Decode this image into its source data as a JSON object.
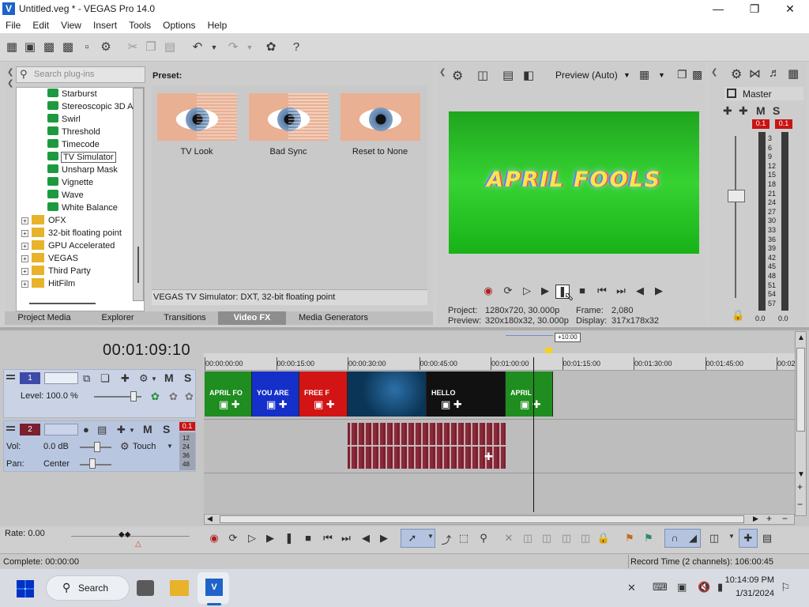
{
  "window": {
    "title": "Untitled.veg * - VEGAS Pro 14.0"
  },
  "menu": [
    "File",
    "Edit",
    "View",
    "Insert",
    "Tools",
    "Options",
    "Help"
  ],
  "plugins": {
    "search_placeholder": "Search plug-ins",
    "tree": [
      {
        "label": "Starburst",
        "kind": "fx"
      },
      {
        "label": "Stereoscopic 3D A",
        "kind": "fx"
      },
      {
        "label": "Swirl",
        "kind": "fx"
      },
      {
        "label": "Threshold",
        "kind": "fx"
      },
      {
        "label": "Timecode",
        "kind": "fx"
      },
      {
        "label": "TV Simulator",
        "kind": "fx",
        "selected": true
      },
      {
        "label": "Unsharp Mask",
        "kind": "fx"
      },
      {
        "label": "Vignette",
        "kind": "fx"
      },
      {
        "label": "Wave",
        "kind": "fx"
      },
      {
        "label": "White Balance",
        "kind": "fx"
      },
      {
        "label": "OFX",
        "kind": "folder"
      },
      {
        "label": "32-bit floating point",
        "kind": "folder"
      },
      {
        "label": "GPU Accelerated",
        "kind": "folder"
      },
      {
        "label": "VEGAS",
        "kind": "folder"
      },
      {
        "label": "Third Party",
        "kind": "folder"
      },
      {
        "label": "HitFilm",
        "kind": "folder"
      }
    ],
    "preset_label": "Preset:",
    "presets": [
      "TV Look",
      "Bad Sync",
      "Reset to None"
    ],
    "status": "VEGAS TV Simulator: DXT, 32-bit floating point",
    "tabs": [
      "Project Media",
      "Explorer",
      "Transitions",
      "Video FX",
      "Media Generators"
    ],
    "active_tab": "Video FX"
  },
  "preview": {
    "mode": "Preview (Auto)",
    "overlay_text": "APRIL FOOLS",
    "project_label": "Project:",
    "project_value": "1280x720, 30.000p",
    "preview_label": "Preview:",
    "preview_value": "320x180x32, 30.000p",
    "frame_label": "Frame:",
    "frame_value": "2,080",
    "display_label": "Display:",
    "display_value": "317x178x32"
  },
  "mixer": {
    "title": "Master",
    "peak_left": "0.1",
    "peak_right": "0.1",
    "scale": [
      "3",
      "6",
      "9",
      "12",
      "15",
      "18",
      "21",
      "24",
      "27",
      "30",
      "33",
      "36",
      "39",
      "42",
      "45",
      "48",
      "51",
      "54",
      "57"
    ],
    "level_left": "0.0",
    "level_right": "0.0"
  },
  "timeline": {
    "timecode": "00:01:09:10",
    "cursor_offset": "+10:00",
    "ruler": [
      "00:00:00:00",
      "00:00:15:00",
      "00:00:30:00",
      "00:00:45:00",
      "00:01:00:00",
      "00:01:15:00",
      "00:01:30:00",
      "00:01:45:00",
      "00:02"
    ],
    "video_track": {
      "number": "1",
      "level": "Level: 100.0 %"
    },
    "audio_track": {
      "number": "2",
      "vol_label": "Vol:",
      "vol_value": "0.0 dB",
      "pan_label": "Pan:",
      "pan_value": "Center",
      "automation": "Touch",
      "peak": "0.1",
      "meter_scale": [
        "12",
        "24",
        "36",
        "48"
      ]
    },
    "clips": [
      {
        "label": "APRIL FO",
        "color": "#1f8d1f"
      },
      {
        "label": "YOU ARE",
        "color": "#1530c8"
      },
      {
        "label": "FREE F",
        "color": "#d21414"
      },
      {
        "label": "",
        "color": "#0a3556"
      },
      {
        "label": "HELLO",
        "color": "#111111"
      },
      {
        "label": "APRIL",
        "color": "#1f8d1f"
      }
    ]
  },
  "bottom": {
    "rate": "Rate: 0.00",
    "complete": "Complete: 00:00:00",
    "record_time": "Record Time (2 channels): 106:00:45"
  },
  "taskbar": {
    "search": "Search",
    "time": "10:14:09 PM",
    "date": "1/31/2024"
  }
}
